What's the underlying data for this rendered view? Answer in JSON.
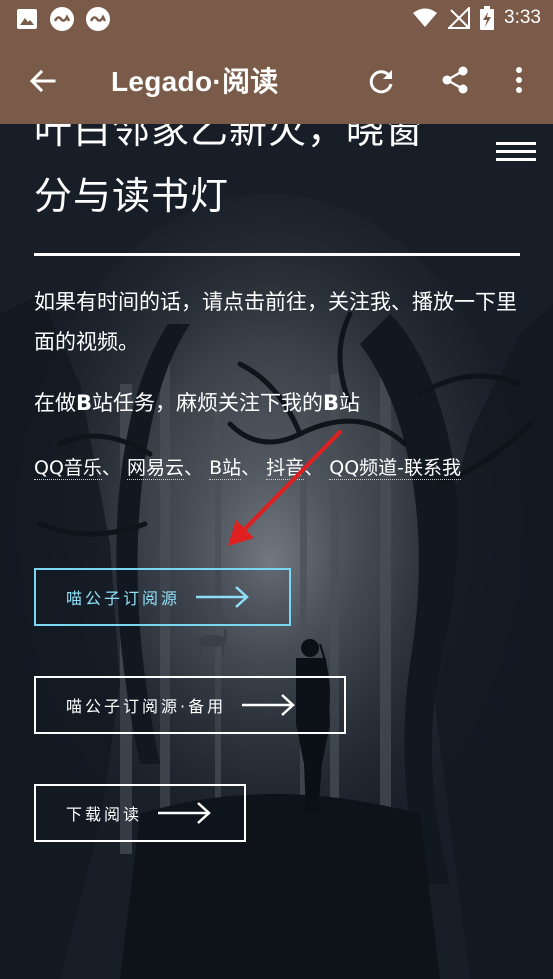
{
  "status_bar": {
    "time": "3:33",
    "icons": [
      "image-icon",
      "link-icon",
      "link-icon",
      "wifi-icon",
      "no-signal-icon",
      "battery-charging-icon"
    ]
  },
  "app_bar": {
    "title": "Legado·阅读",
    "icons": [
      "back-arrow-icon",
      "refresh-icon",
      "share-icon",
      "more-vert-icon"
    ]
  },
  "page": {
    "heading_line1": "叶白邻家乙新火，晓窗",
    "heading_line2": "分与读书灯",
    "paragraph1": "如果有时间的话，请点击前往，关注我、播放一下里面的视频。",
    "paragraph2_pre": "在做",
    "paragraph2_b1": "B",
    "paragraph2_mid": "站任务，麻烦关注下我的",
    "paragraph2_b2": "B",
    "paragraph2_post": "站",
    "links": [
      {
        "label": "QQ音乐"
      },
      {
        "label": "网易云"
      },
      {
        "label": "B站"
      },
      {
        "label": "抖音"
      },
      {
        "label": "QQ频道-联系我"
      }
    ],
    "link_separator": "、",
    "buttons": [
      {
        "label": "喵公子订阅源"
      },
      {
        "label": "喵公子订阅源·备用"
      },
      {
        "label": "下载阅读"
      }
    ]
  },
  "colors": {
    "app_bar": "#7a5a48",
    "background": "#171e27",
    "active_button": "#7ad6f2",
    "annotation_arrow": "#e02020"
  }
}
